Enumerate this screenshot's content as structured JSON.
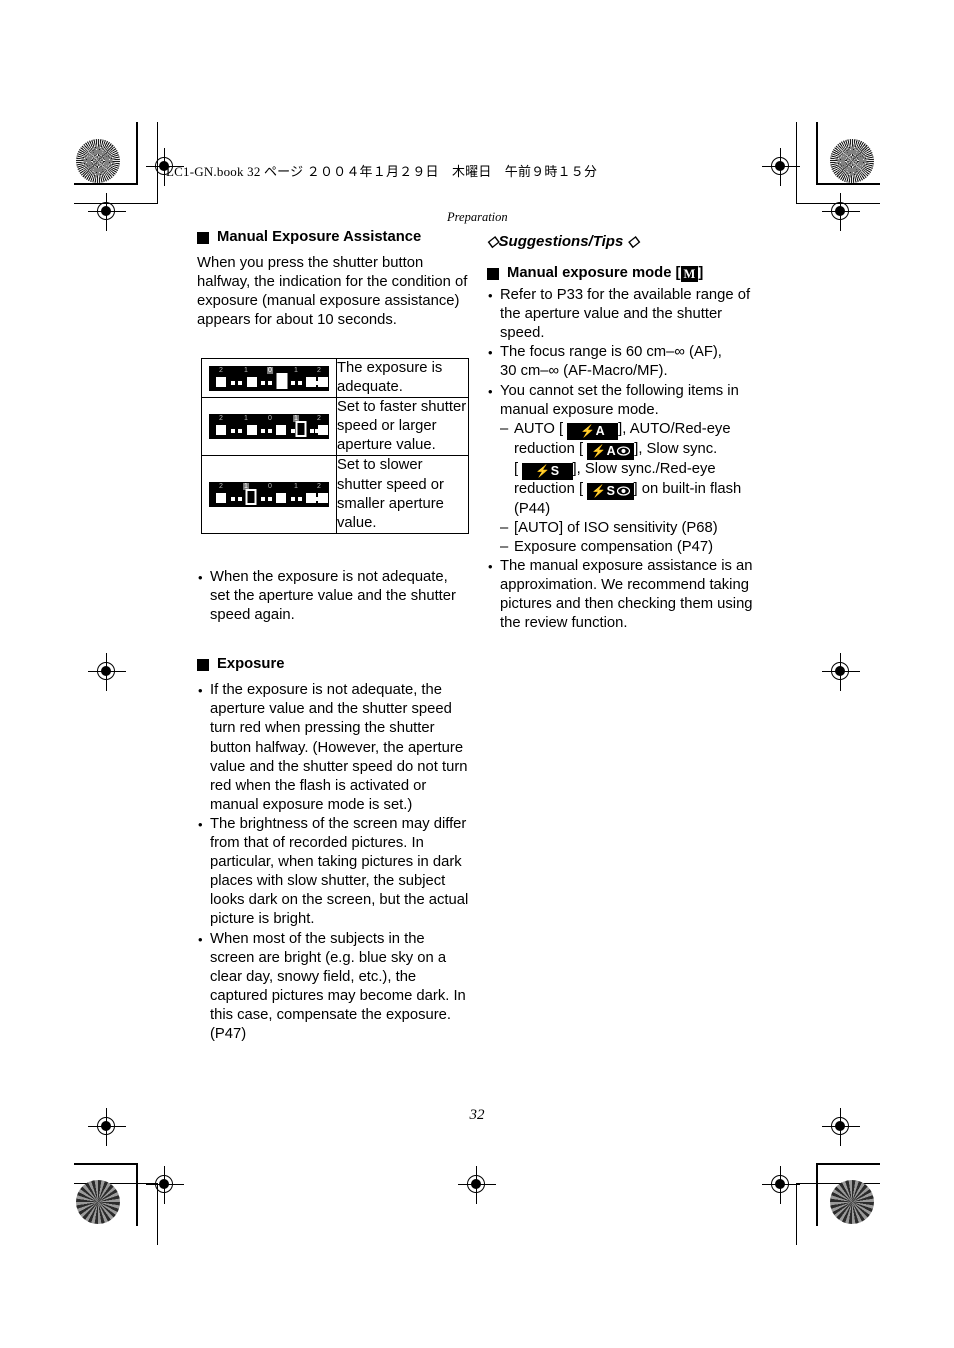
{
  "header": {
    "running_head": "LC1-GN.book   32 ページ   ２００４年１月２９日　木曜日　午前９時１５分",
    "section_label": "Preparation"
  },
  "left_column": {
    "heading": "Manual Exposure Assistance",
    "intro": "When you press the shutter button halfway, the indication for the condition of exposure (manual exposure assistance) appears for about 10 seconds.",
    "table": {
      "rows": [
        {
          "meter_name": "exposure-meter-adequate",
          "description": "The exposure is adequate.",
          "scale_labels": [
            "2",
            "1",
            "0",
            "1",
            "2"
          ],
          "indicator_position": "center"
        },
        {
          "meter_name": "exposure-meter-overexposed",
          "description": "Set to faster shutter speed or larger aperture value.",
          "scale_labels": [
            "2",
            "1",
            "0",
            "1",
            "2"
          ],
          "indicator_position": "plus-one"
        },
        {
          "meter_name": "exposure-meter-underexposed",
          "description": "Set to slower shutter speed or smaller aperture value.",
          "scale_labels": [
            "2",
            "1",
            "0",
            "1",
            "2"
          ],
          "indicator_position": "minus-one"
        }
      ]
    },
    "after_table_bullet": "When the exposure is not adequate, set the aperture value and the shutter speed again.",
    "exposure_heading": "Exposure",
    "exposure_bullets": [
      "If the exposure is not adequate, the aperture value and the shutter speed turn red when pressing the shutter button halfway. (However, the aperture value and the shutter speed do not turn red when the flash is activated or manual exposure mode is set.)",
      "The brightness of the screen may differ from that of recorded pictures. In particular, when taking pictures in dark places with slow shutter, the subject looks dark on the screen, but the actual picture is bright.",
      "When most of the subjects in the screen are bright (e.g. blue sky on a clear day, snowy field, etc.), the captured pictures may become dark. In this case, compensate the exposure. (P47)"
    ]
  },
  "right_column": {
    "tips_title": "Suggestions/Tips",
    "tips_diamond": "◇",
    "heading_prefix": "Manual exposure mode [",
    "heading_mode_badge": "M",
    "heading_suffix": "]",
    "bullet_1": "Refer to P33 for the available range of the aperture value and the shutter speed.",
    "bullet_2_a": "The focus range is 60 cm–∞ (AF),",
    "bullet_2_b": "30 cm–∞ (AF-Macro/MF).",
    "bullet_3_intro": "You cannot set the following items in manual exposure mode.",
    "flash_line": {
      "auto_label": "AUTO [",
      "auto_badge": "⚡A",
      "after_auto": "], AUTO/Red-eye",
      "redeye_label": "reduction [",
      "redeye_badge": "⚡A",
      "after_redeye": "], Slow sync.",
      "slow_open": "[",
      "slow_badge": "⚡S",
      "after_slow": "], Slow sync./Red-eye",
      "slow_redeye_label": "reduction [",
      "slow_redeye_badge": "⚡S",
      "after_slow_redeye": "] on built-in flash",
      "page_ref": "(P44)"
    },
    "dash_items": [
      "[AUTO] of ISO sensitivity (P68)",
      "Exposure compensation (P47)"
    ],
    "bullet_last": "The manual exposure assistance is an approximation. We recommend taking pictures and then checking them using the review function."
  },
  "footer": {
    "page_number": "32"
  },
  "colors": {
    "ink": "#000000",
    "paper": "#ffffff",
    "meter_background": "#000000",
    "meter_mark": "#ffffff"
  }
}
